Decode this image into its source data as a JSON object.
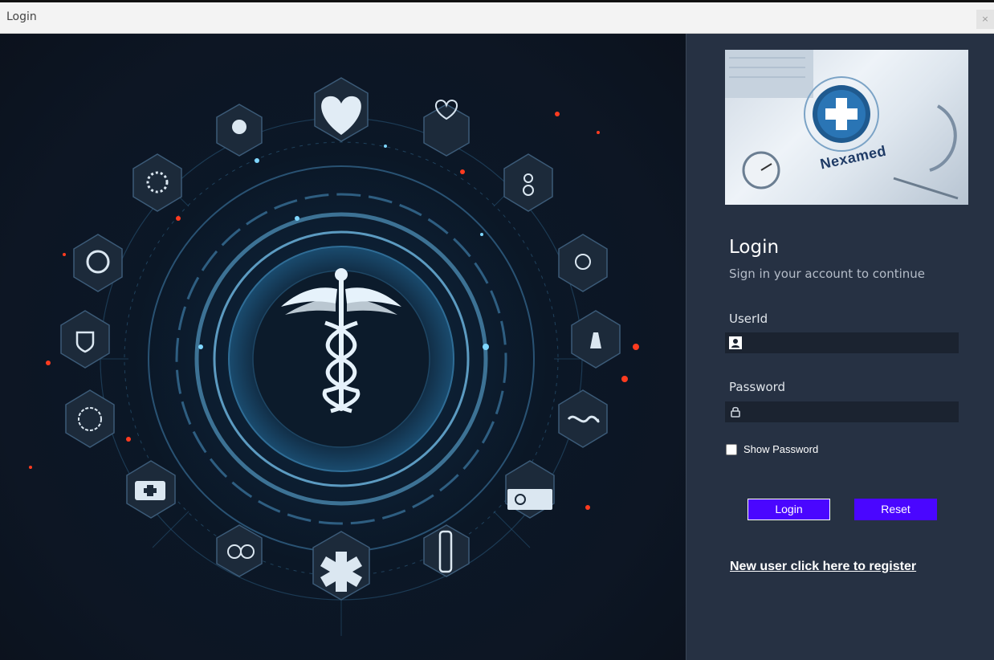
{
  "window": {
    "title": "Login",
    "close_glyph": "×"
  },
  "hero": {
    "icons": [
      "heart-icon",
      "caduceus-icon",
      "medical-star-icon",
      "first-aid-icon",
      "lab-icon"
    ],
    "accent": "#5ec8ff",
    "spark": "#ff3b1f"
  },
  "banner": {
    "brand": "Nexamed"
  },
  "form": {
    "heading": "Login",
    "subheading": "Sign in your account to continue",
    "userid_label": "UserId",
    "userid_value": "",
    "password_label": "Password",
    "password_value": "",
    "show_password_label": "Show Password",
    "show_password_checked": false,
    "login_label": "Login",
    "reset_label": "Reset",
    "register_label": "New user click here to register"
  },
  "colors": {
    "panel_bg": "#263143",
    "field_bg": "#1b2330",
    "button": "#4a06ff"
  }
}
